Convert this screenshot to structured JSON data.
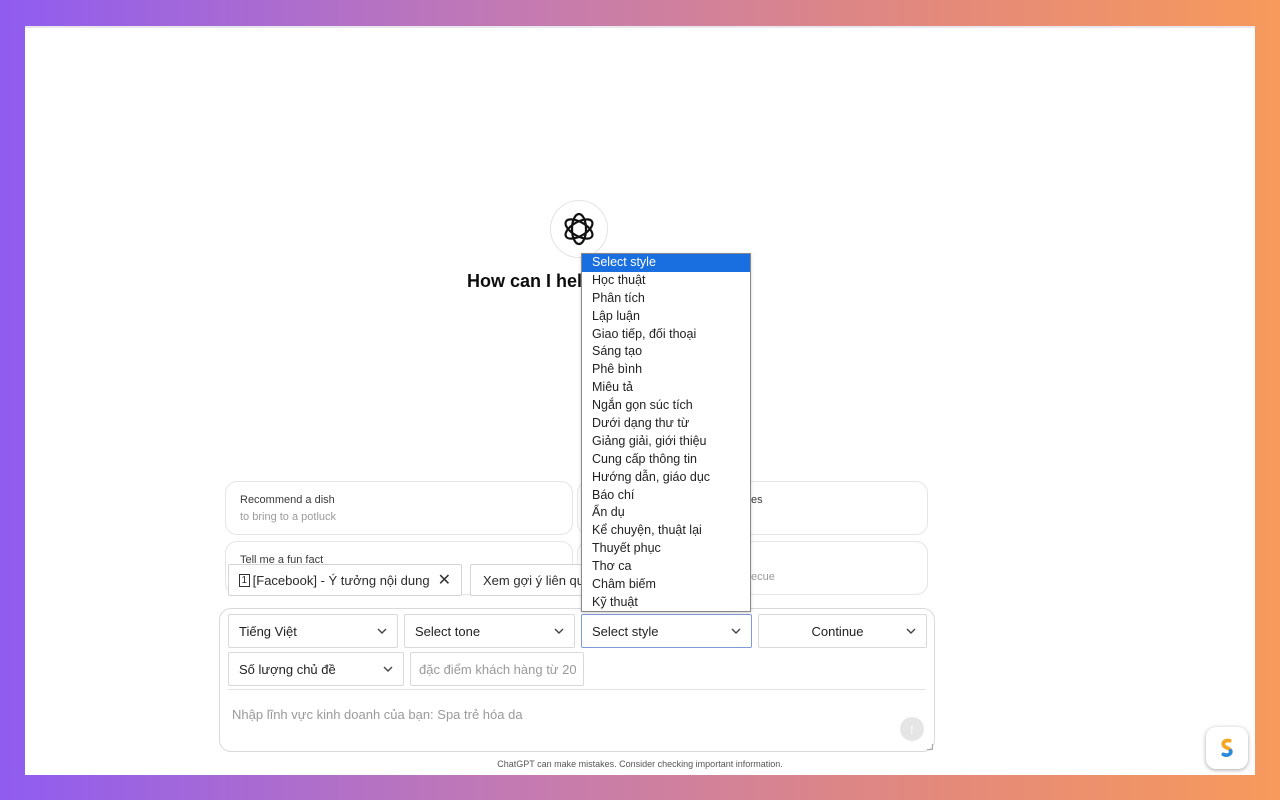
{
  "main": {
    "headline": "How can I hel"
  },
  "cards": [
    {
      "title": "Recommend a dish",
      "subtitle": "to bring to a potluck"
    },
    {
      "title": "es",
      "subtitle": ""
    },
    {
      "title": "Tell me a fun fact",
      "subtitle": ""
    },
    {
      "title": "",
      "subtitle": "ecue"
    }
  ],
  "chips": {
    "facebook": {
      "icon": "1",
      "label": "[Facebook] - Ý tưởng nội dung"
    },
    "suggest": {
      "label": "Xem gợi ý liên qu"
    }
  },
  "composer": {
    "language": "Tiếng Việt",
    "tone": "Select tone",
    "style": "Select style",
    "continue": "Continue",
    "topic_count": "Số lượng chủ đề",
    "customer_input_value": "đặc điểm khách hàng từ 20",
    "message_placeholder": "Nhập lĩnh vực kinh doanh của bạn: Spa trẻ hóa da"
  },
  "dropdown": {
    "options": [
      "Select style",
      "Học thuật",
      "Phân tích",
      "Lập luận",
      "Giao tiếp, đối thoại",
      "Sáng tạo",
      "Phê bình",
      "Miêu tả",
      "Ngắn gọn súc tích",
      "Dưới dạng thư từ",
      "Giảng giải, giới thiệu",
      "Cung cấp thông tin",
      "Hướng dẫn, giáo dục",
      "Báo chí",
      "Ẩn dụ",
      "Kể chuyện, thuật lại",
      "Thuyết phục",
      "Thơ ca",
      "Châm biếm",
      "Kỹ thuật"
    ],
    "selected_index": 0
  },
  "footer": {
    "disclaimer": "ChatGPT can make mistakes. Consider checking important information."
  },
  "colors": {
    "highlight": "#1a6fe0",
    "gradient_left": "#8f5cf0",
    "gradient_right": "#f79a5c"
  }
}
